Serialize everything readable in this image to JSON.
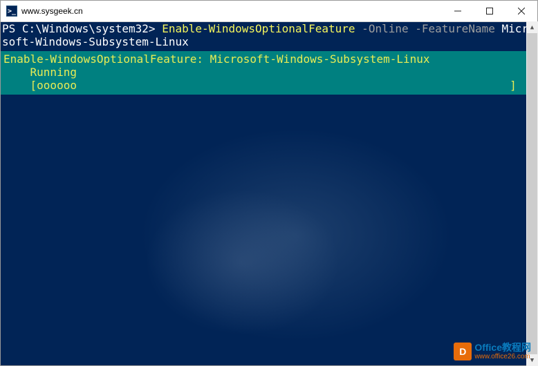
{
  "titlebar": {
    "icon_glyph": ">_",
    "title": "www.sysgeek.cn"
  },
  "terminal": {
    "prompt": "PS C:\\Windows\\system32> ",
    "command": {
      "cmdlet": "Enable-WindowsOptionalFeature",
      "param1": " -Online ",
      "param2": "-FeatureName ",
      "value": "Microsoft-Windows-Subsystem-Linux"
    },
    "progress": {
      "header": "Enable-WindowsOptionalFeature: Microsoft-Windows-Subsystem-Linux",
      "status": "    Running",
      "bar": "    [oooooo                                                                 ]"
    }
  },
  "watermark": {
    "logo_char": "D",
    "line1": "Office教程网",
    "line2": "www.office26.com"
  }
}
